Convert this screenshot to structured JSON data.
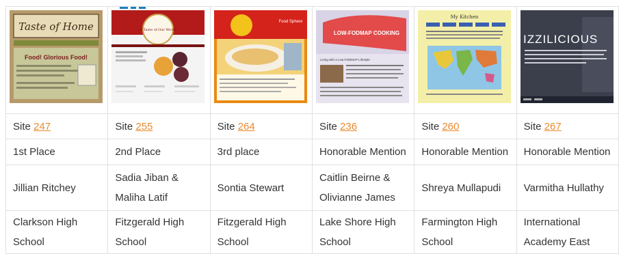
{
  "columns": [
    {
      "site_prefix": "Site",
      "site_number": "247",
      "place": "1st Place",
      "student": "Jillian Ritchey",
      "school": "Clarkson High School",
      "thumb": {
        "title": "Taste of Home",
        "headline": "Food! Glorious Food!",
        "colors": {
          "bg": "#b79a6a",
          "banner": "#3e2a16",
          "nav": "#7e8a3a",
          "body": "#c7c79a",
          "headline": "#f6f2da"
        }
      }
    },
    {
      "site_prefix": "Site",
      "site_number": "255",
      "place": "2nd Place",
      "student": "Sadia Jiban & Maliha Latif",
      "school": "Fitzgerald High School",
      "thumb": {
        "title": "A Taste of Our World",
        "headline": "",
        "colors": {
          "bg": "#f4f4f4",
          "banner": "#b31b1b",
          "nav": "#7a1212",
          "body": "#ffffff",
          "headline": "#3a3a3a"
        }
      }
    },
    {
      "site_prefix": "Site",
      "site_number": "264",
      "place": "3rd place",
      "student": "Sontia Stewart",
      "school": "Fitzgerald High School",
      "thumb": {
        "title": "Food Sphere",
        "headline": "",
        "colors": {
          "bg": "#e98a12",
          "banner": "#d4231b",
          "nav": "#f3c21b",
          "body": "#fff8e6",
          "headline": "#ffffff"
        }
      }
    },
    {
      "site_prefix": "Site",
      "site_number": "236",
      "place": "Honorable Mention",
      "student": "Caitlin Beirne & Olivianne James",
      "school": "Lake Shore High School",
      "thumb": {
        "title": "LOW-FODMAP COOKING",
        "headline": "Living with a Low-FODMAP Lifestyle",
        "colors": {
          "bg": "#e7e3ef",
          "banner": "#e34a4a",
          "nav": "#c9c3db",
          "body": "#f6f4fa",
          "headline": "#ffffff"
        }
      }
    },
    {
      "site_prefix": "Site",
      "site_number": "260",
      "place": "Honorable Mention",
      "student": "Shreya Mullapudi",
      "school": "Farmington High School",
      "thumb": {
        "title": "My Kitchen",
        "headline": "",
        "colors": {
          "bg": "#f3efa8",
          "banner": "#f3efa8",
          "nav": "#3a5fb0",
          "body": "#f7f3b9",
          "headline": "#333333"
        }
      }
    },
    {
      "site_prefix": "Site",
      "site_number": "267",
      "place": "Honorable Mention",
      "student": "Varmitha Hullathy",
      "school": "International Academy East",
      "thumb": {
        "title": "IZZILICIOUS",
        "headline": "",
        "colors": {
          "bg": "#2d3344",
          "banner": "#2d3344",
          "nav": "#1f2430",
          "body": "#3b3f4c",
          "headline": "#ffffff"
        }
      }
    }
  ]
}
